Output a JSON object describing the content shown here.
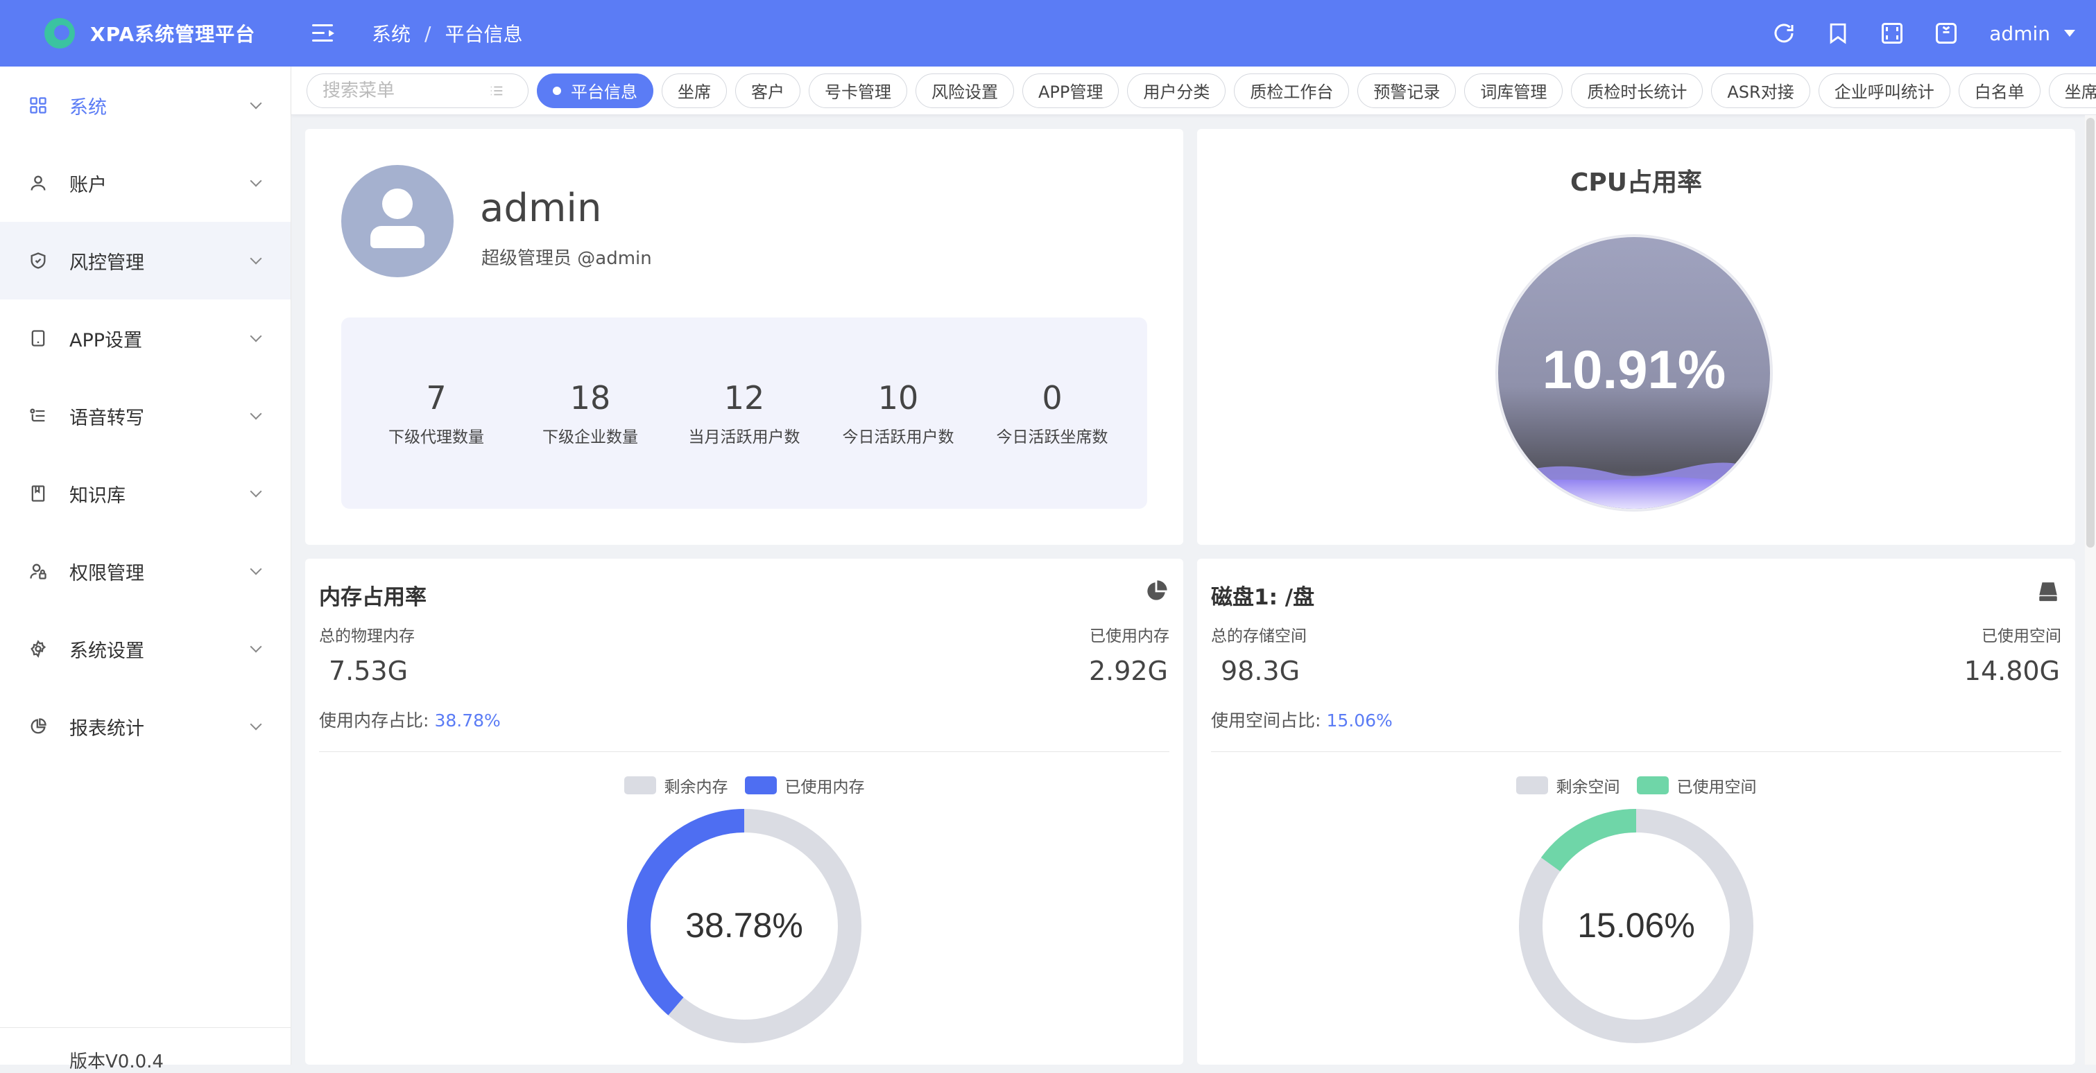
{
  "colors": {
    "primary": "#5b7cf5",
    "memory_used": "#4e6ef2",
    "disk_used": "#6fd6a8",
    "remaining": "#dadce3"
  },
  "header": {
    "app_title": "XPA系统管理平台",
    "breadcrumb": [
      "系统",
      "平台信息"
    ],
    "breadcrumb_sep": "/",
    "user": "admin",
    "icons": [
      "refresh-icon",
      "bookmark-icon",
      "fullscreen-icon",
      "shirt-icon"
    ]
  },
  "sidebar": {
    "items": [
      {
        "label": "系统",
        "icon": "grid-icon",
        "active": true
      },
      {
        "label": "账户",
        "icon": "user-icon"
      },
      {
        "label": "风控管理",
        "icon": "shield-icon"
      },
      {
        "label": "APP设置",
        "icon": "tablet-icon"
      },
      {
        "label": "语音转写",
        "icon": "flow-icon"
      },
      {
        "label": "知识库",
        "icon": "book-icon"
      },
      {
        "label": "权限管理",
        "icon": "user-lock-icon"
      },
      {
        "label": "系统设置",
        "icon": "gear-icon"
      },
      {
        "label": "报表统计",
        "icon": "pie-icon"
      }
    ],
    "version": "版本V0.0.4"
  },
  "tabs": {
    "search_placeholder": "搜索菜单",
    "items": [
      "平台信息",
      "坐席",
      "客户",
      "号卡管理",
      "风险设置",
      "APP管理",
      "用户分类",
      "质检工作台",
      "预警记录",
      "词库管理",
      "质检时长统计",
      "ASR对接",
      "企业呼叫统计",
      "白名单",
      "坐席呼叫统计"
    ],
    "active_index": 0
  },
  "profile": {
    "name": "admin",
    "role": "超级管理员 @admin",
    "stats": [
      {
        "value": "7",
        "label": "下级代理数量"
      },
      {
        "value": "18",
        "label": "下级企业数量"
      },
      {
        "value": "12",
        "label": "当月活跃用户数"
      },
      {
        "value": "10",
        "label": "今日活跃用户数"
      },
      {
        "value": "0",
        "label": "今日活跃坐席数"
      }
    ]
  },
  "cpu": {
    "title": "CPU占用率",
    "value_text": "10.91%",
    "value": 10.91
  },
  "memory": {
    "title": "内存占用率",
    "total_label": "总的物理内存",
    "total_value": "7.53G",
    "used_label": "已使用内存",
    "used_value": "2.92G",
    "ratio_label": "使用内存占比:",
    "ratio_value": "38.78%",
    "legend_free": "剩余内存",
    "legend_used": "已使用内存",
    "icon": "pie-chart-icon"
  },
  "disk": {
    "title": "磁盘1: /盘",
    "total_label": "总的存储空间",
    "total_value": "98.3G",
    "used_label": "已使用空间",
    "used_value": "14.80G",
    "ratio_label": "使用空间占比:",
    "ratio_value": "15.06%",
    "legend_free": "剩余空间",
    "legend_used": "已使用空间",
    "icon": "hard-drive-icon"
  },
  "chart_data": [
    {
      "type": "pie",
      "categories": [
        "剩余内存",
        "已使用内存"
      ],
      "values": [
        61.22,
        38.78
      ]
    },
    {
      "type": "pie",
      "categories": [
        "剩余空间",
        "已使用空间"
      ],
      "values": [
        84.94,
        15.06
      ]
    }
  ]
}
